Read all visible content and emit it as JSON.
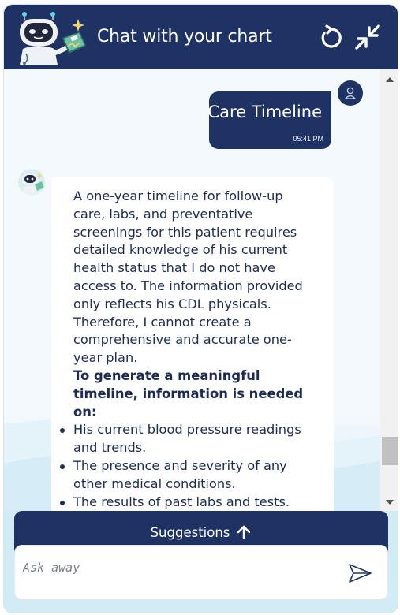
{
  "header": {
    "title": "Chat with your chart"
  },
  "messages": {
    "user": {
      "text": "Care Timeline",
      "time": "05:41 PM"
    },
    "bot": {
      "paragraph": "A one-year timeline for follow-up care, labs, and preventative screenings for this patient requires detailed knowledge of his current health status that I do not have access to. The information provided only reflects his CDL physicals. Therefore, I cannot create a comprehensive and accurate one-year plan.",
      "bold_heading": "To generate a meaningful timeline, information is needed on:",
      "items": [
        "His current blood pressure readings and trends.",
        "The presence and severity of any other medical conditions.",
        "The results of past labs and tests."
      ]
    }
  },
  "suggestions": {
    "label": "Suggestions"
  },
  "input": {
    "placeholder": "Ask away"
  },
  "colors": {
    "brand_navy": "#1e3263",
    "chat_bg": "#f4f9fd",
    "accent_light_blue": "#d2ecf6"
  },
  "icons": {
    "header_logo": "robot-assistant-icon",
    "refresh": "refresh-icon",
    "minimize": "minimize-icon",
    "user": "user-avatar-icon",
    "bot": "bot-avatar-icon",
    "suggestions_arrow": "arrow-up-icon",
    "send": "send-icon"
  }
}
